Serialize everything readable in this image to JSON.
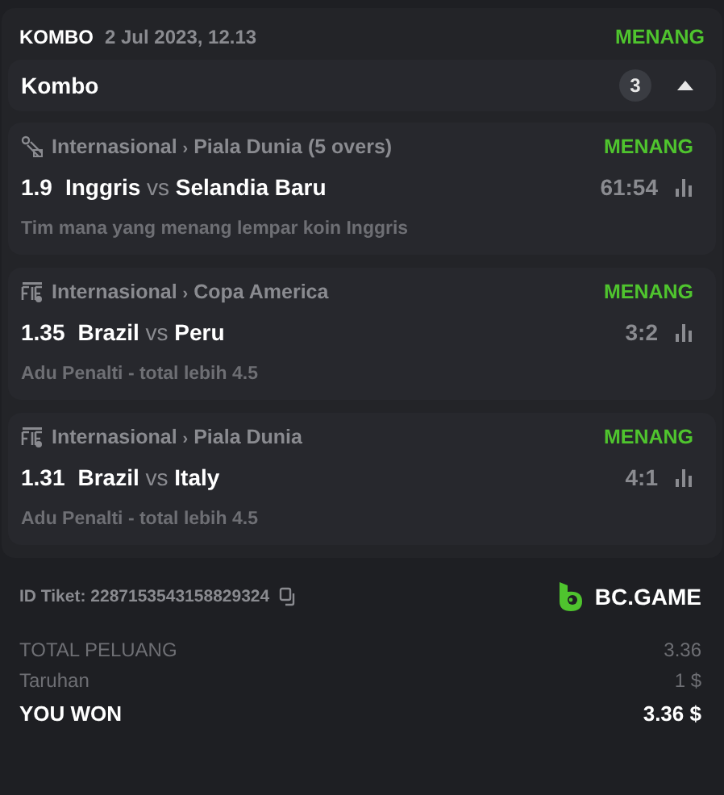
{
  "header": {
    "type": "KOMBO",
    "date": "2 Jul 2023, 12.13",
    "status": "MENANG"
  },
  "combo": {
    "title": "Kombo",
    "count": "3",
    "expanded": true
  },
  "matches": [
    {
      "kind": "cricket",
      "region": "Internasional",
      "separator": "›",
      "league": "Piala Dunia (5 overs)",
      "status": "MENANG",
      "odds": "1.9",
      "home": "Inggris",
      "vs": "vs",
      "away": "Selandia Baru",
      "score": "61:54",
      "selection": "Tim mana yang menang lempar koin Inggris"
    },
    {
      "kind": "penalty",
      "region": "Internasional",
      "separator": "›",
      "league": "Copa America",
      "status": "MENANG",
      "odds": "1.35",
      "home": "Brazil",
      "vs": "vs",
      "away": "Peru",
      "score": "3:2",
      "selection": "Adu Penalti - total lebih 4.5"
    },
    {
      "kind": "penalty",
      "region": "Internasional",
      "separator": "›",
      "league": "Piala Dunia",
      "status": "MENANG",
      "odds": "1.31",
      "home": "Brazil",
      "vs": "vs",
      "away": "Italy",
      "score": "4:1",
      "selection": "Adu Penalti - total lebih 4.5"
    }
  ],
  "ticket": {
    "label": "ID Tiket: 2287153543158829324",
    "brand": "BC.GAME"
  },
  "summary": [
    {
      "kind": "plain",
      "label": "TOTAL PELUANG",
      "value": "3.36"
    },
    {
      "kind": "plain",
      "label": "Taruhan",
      "value": "1 $"
    },
    {
      "kind": "total",
      "label": "YOU WON",
      "value": "3.36 $"
    }
  ]
}
